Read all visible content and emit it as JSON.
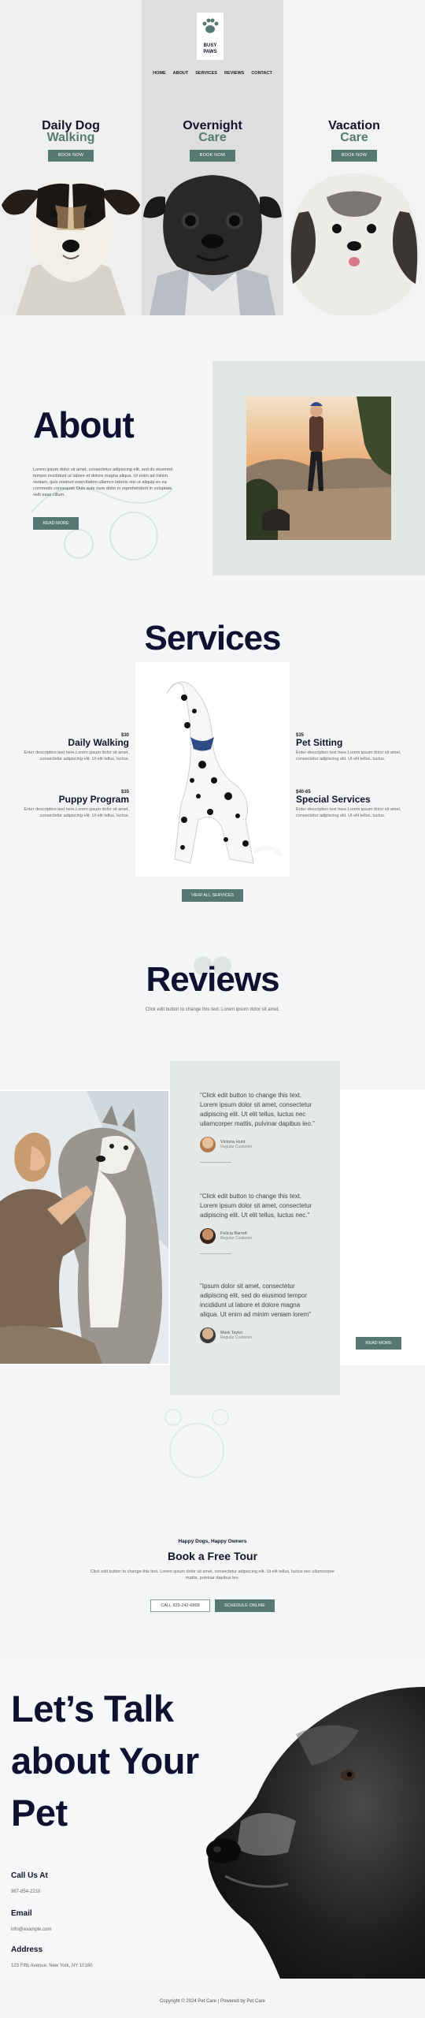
{
  "brand": {
    "logo_text": "BUSY PAWS"
  },
  "nav": {
    "items": [
      "HOME",
      "ABOUT",
      "SERVICES",
      "REVIEWS",
      "CONTACT"
    ]
  },
  "hero": {
    "columns": [
      {
        "line1": "Daily Dog",
        "line2": "Walking",
        "button": "BOOK NOW"
      },
      {
        "line1": "Overnight",
        "line2": "Care",
        "button": "BOOK NOW"
      },
      {
        "line1": "Vacation",
        "line2": "Care",
        "button": "BOOK NOW"
      }
    ]
  },
  "about": {
    "title": "About",
    "text": "Lorem ipsum dolor sit amet, consectetur adipiscing elit, sed do eiusmod tempor incididunt ut labore et dolore magna aliqua. Ut enim ad minim veniam, quis nostrud exercitation ullamco laboris nisi ut aliquip ex ea commodo consequat. Duis aute irure dolor in reprehenderit in voluptate velit esse cillum.",
    "button": "READ MORE"
  },
  "services": {
    "title": "Services",
    "items": [
      {
        "price": "$30",
        "name": "Daily Walking",
        "desc": "Enter description text here.Lorem ipsum dolor sit amet, consectetur adipiscing elit. Ut elit tellus, luctus."
      },
      {
        "price": "$35",
        "name": "Puppy Program",
        "desc": "Enter description text here.Lorem ipsum dolor sit amet, consectetur adipiscing elit. Ut elit tellus, luctus."
      },
      {
        "price": "$35",
        "name": "Pet Sitting",
        "desc": "Enter description text here.Lorem ipsum dolor sit amet, consectetur adipiscing elit. Ut elit tellus, luctus."
      },
      {
        "price": "$40-65",
        "name": "Special Services",
        "desc": "Enter description text here.Lorem ipsum dolor sit amet, consectetur adipiscing elit. Ut elit tellus, luctus."
      }
    ],
    "button": "VIEW ALL SERVICES"
  },
  "reviews": {
    "title": "Reviews",
    "subtitle": "Click edit button to change this text. Lorem ipsum dolor sit amet.",
    "items": [
      {
        "quote": "\"Click edit button to change this text. Lorem ipsum dolor sit amet, consectetur adipiscing elit. Ut elit tellus, luctus nec ullamcorper mattis, pulvinar dapibus leo.\"",
        "name": "Victoria Hunt",
        "role": "Regular Customer"
      },
      {
        "quote": "\"Click edit button to change this text. Lorem ipsum dolor sit amet, consectetur adipiscing elit. Ut elit tellus, luctus nec.\"",
        "name": "Felicia Barrett",
        "role": "Regular Customer"
      },
      {
        "quote": "\"Ipsum dolor sit amet, consectetur adipiscing elit, sed do eiusmod tempor incididunt ut labore et dolore magna aliqua. Ut enim ad minim veniam lorem\"",
        "name": "Mark Taylor",
        "role": "Regular Customer"
      }
    ],
    "button": "READ MORE"
  },
  "tour": {
    "kicker": "Happy Dogs, Happy Owners",
    "title": "Book a Free Tour",
    "text": "Click edit button to change this text. Lorem ipsum dolor sit amet, consectetur adipiscing elit. Ut elit tellus, luctus nec ullamcorper mattis, pulvinar dapibus leo.",
    "call_button": "CALL 929-242-6868",
    "schedule_button": "SCHEDULE ONLINE"
  },
  "contact": {
    "title_lines": [
      "Let’s Talk",
      "about Your",
      "Pet"
    ],
    "call_label": "Call Us At",
    "call_value": "987-854-2210",
    "email_label": "Email",
    "email_value": "info@example.com",
    "address_label": "Address",
    "address_value": "123 Fifth Avenue, New York, NY 10160"
  },
  "footer": {
    "text": "Copyright © 2024 Pet Care | Powered by Pet Care"
  },
  "colors": {
    "accent": "#557870",
    "dark": "#0f1130",
    "panel": "#e4e9e8"
  }
}
